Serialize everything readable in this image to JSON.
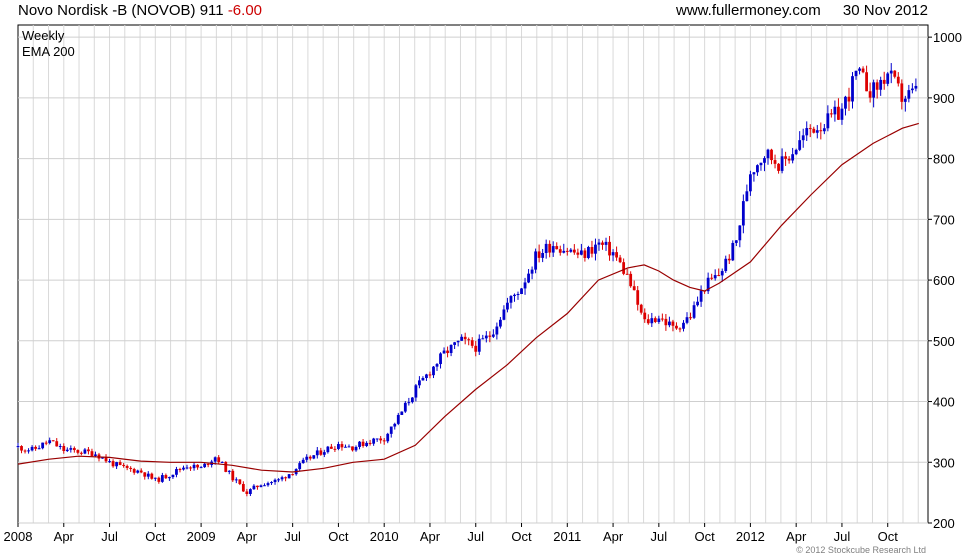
{
  "header": {
    "name": "Novo Nordisk -B (NOVOB)",
    "price": "911",
    "change": "-6.00",
    "site": "www.fullermoney.com",
    "date": "30 Nov 2012"
  },
  "copyright": "© 2012 Stockcube Research Ltd",
  "colors": {
    "up": "#0000cc",
    "down": "#dd0000",
    "ema": "#990000",
    "grid": "#d9d9d9",
    "axis": "#000000"
  },
  "chart_data": {
    "type": "line",
    "legend": [
      "Weekly",
      "EMA 200"
    ],
    "legend_colors": [
      "#0000aa",
      "#990000"
    ],
    "legend_position": "top-left",
    "grid": true,
    "y_axis_position": "right",
    "ylim": [
      200,
      1020
    ],
    "y_ticks": [
      200,
      300,
      400,
      500,
      600,
      700,
      800,
      900,
      1000
    ],
    "xlim": [
      2008.0,
      2012.97
    ],
    "x_ticks": [
      {
        "t": 2008.0,
        "label": "2008"
      },
      {
        "t": 2008.25,
        "label": "Apr"
      },
      {
        "t": 2008.5,
        "label": "Jul"
      },
      {
        "t": 2008.75,
        "label": "Oct"
      },
      {
        "t": 2009.0,
        "label": "2009"
      },
      {
        "t": 2009.25,
        "label": "Apr"
      },
      {
        "t": 2009.5,
        "label": "Jul"
      },
      {
        "t": 2009.75,
        "label": "Oct"
      },
      {
        "t": 2010.0,
        "label": "2010"
      },
      {
        "t": 2010.25,
        "label": "Apr"
      },
      {
        "t": 2010.5,
        "label": "Jul"
      },
      {
        "t": 2010.75,
        "label": "Oct"
      },
      {
        "t": 2011.0,
        "label": "2011"
      },
      {
        "t": 2011.25,
        "label": "Apr"
      },
      {
        "t": 2011.5,
        "label": "Jul"
      },
      {
        "t": 2011.75,
        "label": "Oct"
      },
      {
        "t": 2012.0,
        "label": "2012"
      },
      {
        "t": 2012.25,
        "label": "Apr"
      },
      {
        "t": 2012.5,
        "label": "Jul"
      },
      {
        "t": 2012.75,
        "label": "Oct"
      }
    ],
    "series": [
      {
        "name": "Weekly",
        "x": [
          2008.0,
          2008.08,
          2008.17,
          2008.25,
          2008.33,
          2008.42,
          2008.5,
          2008.58,
          2008.67,
          2008.75,
          2008.83,
          2008.92,
          2009.0,
          2009.08,
          2009.17,
          2009.25,
          2009.33,
          2009.42,
          2009.5,
          2009.58,
          2009.67,
          2009.75,
          2009.83,
          2009.92,
          2010.0,
          2010.08,
          2010.17,
          2010.25,
          2010.33,
          2010.42,
          2010.5,
          2010.58,
          2010.67,
          2010.75,
          2010.83,
          2010.92,
          2011.0,
          2011.08,
          2011.17,
          2011.25,
          2011.33,
          2011.42,
          2011.5,
          2011.58,
          2011.67,
          2011.75,
          2011.83,
          2011.92,
          2012.0,
          2012.08,
          2012.17,
          2012.25,
          2012.33,
          2012.42,
          2012.5,
          2012.58,
          2012.67,
          2012.75,
          2012.83,
          2012.92
        ],
        "values": [
          325,
          320,
          335,
          320,
          318,
          315,
          300,
          290,
          285,
          270,
          280,
          295,
          290,
          310,
          275,
          250,
          265,
          270,
          285,
          305,
          320,
          330,
          325,
          335,
          340,
          375,
          420,
          450,
          480,
          500,
          490,
          510,
          560,
          590,
          640,
          660,
          650,
          640,
          660,
          645,
          605,
          530,
          540,
          520,
          540,
          590,
          610,
          660,
          780,
          810,
          790,
          820,
          850,
          860,
          880,
          940,
          910,
          940,
          900,
          911
        ]
      },
      {
        "name": "EMA 200",
        "x": [
          2008.0,
          2008.17,
          2008.33,
          2008.5,
          2008.67,
          2008.83,
          2009.0,
          2009.17,
          2009.33,
          2009.5,
          2009.67,
          2009.83,
          2010.0,
          2010.17,
          2010.33,
          2010.5,
          2010.67,
          2010.83,
          2011.0,
          2011.17,
          2011.33,
          2011.42,
          2011.5,
          2011.58,
          2011.67,
          2011.75,
          2011.83,
          2012.0,
          2012.17,
          2012.33,
          2012.5,
          2012.67,
          2012.83,
          2012.92
        ],
        "values": [
          297,
          305,
          310,
          308,
          302,
          300,
          300,
          295,
          287,
          284,
          290,
          300,
          305,
          328,
          375,
          420,
          460,
          505,
          545,
          600,
          620,
          625,
          615,
          600,
          588,
          582,
          595,
          630,
          690,
          740,
          790,
          825,
          850,
          858
        ]
      }
    ]
  }
}
